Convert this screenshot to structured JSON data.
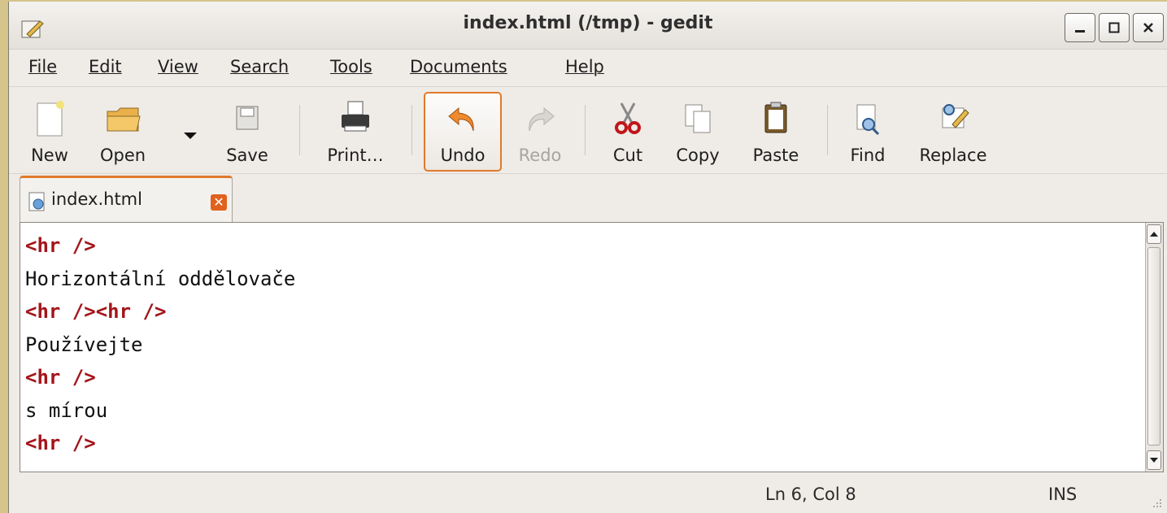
{
  "window": {
    "title": "index.html (/tmp) - gedit"
  },
  "menu": [
    "File",
    "Edit",
    "View",
    "Search",
    "Tools",
    "Documents",
    "Help"
  ],
  "toolbar": {
    "new": "New",
    "open": "Open",
    "save": "Save",
    "print": "Print…",
    "undo": "Undo",
    "redo": "Redo",
    "cut": "Cut",
    "copy": "Copy",
    "paste": "Paste",
    "find": "Find",
    "replace": "Replace"
  },
  "tab": {
    "label": "index.html"
  },
  "editor": {
    "lines": [
      {
        "tag": "<hr />",
        "text": ""
      },
      {
        "tag": "",
        "text": "Horizontální oddělovače"
      },
      {
        "tag": "<hr /><hr />",
        "text": ""
      },
      {
        "tag": "",
        "text": "Používejte"
      },
      {
        "tag": "<hr />",
        "text": ""
      },
      {
        "tag": "",
        "text": "s mírou"
      },
      {
        "tag": "<hr />",
        "text": ""
      }
    ]
  },
  "status": {
    "position": "Ln 6, Col 8",
    "mode": "INS"
  },
  "colors": {
    "accent": "#e07a2a",
    "tag": "#a3151a",
    "background": "#d4c48a"
  }
}
